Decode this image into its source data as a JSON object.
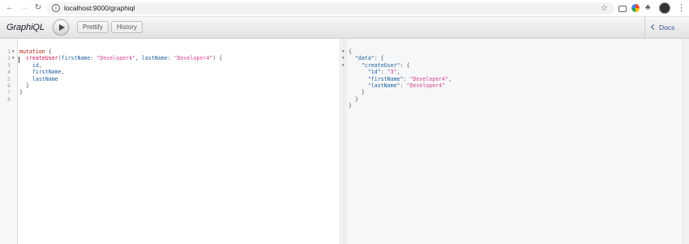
{
  "browser": {
    "url": "localhost:9000/graphiql",
    "back_icon": "arrow-left-icon",
    "forward_icon": "arrow-right-icon",
    "reload_icon": "reload-icon",
    "info_icon": "info-icon",
    "star_icon": "star-icon"
  },
  "toolbar": {
    "title": "GraphiQL",
    "prettify_label": "Prettify",
    "history_label": "History",
    "docs_label": "Docs"
  },
  "query_editor": {
    "line_numbers": [
      "1",
      "2",
      "3",
      "4",
      "5",
      "6",
      "7",
      "8"
    ],
    "lines": [
      [
        {
          "t": "mutation",
          "c": "kw"
        },
        {
          "t": " {",
          "c": "plain"
        }
      ],
      [
        {
          "t": "  ",
          "c": "plain"
        },
        {
          "t": "createUser",
          "c": "def"
        },
        {
          "t": "(",
          "c": "plain"
        },
        {
          "t": "firstName",
          "c": "attr"
        },
        {
          "t": ": ",
          "c": "plain"
        },
        {
          "t": "\"Developer4\"",
          "c": "str"
        },
        {
          "t": ", ",
          "c": "plain"
        },
        {
          "t": "lastName",
          "c": "attr"
        },
        {
          "t": ": ",
          "c": "plain"
        },
        {
          "t": "\"Developer4\"",
          "c": "str"
        },
        {
          "t": ") {",
          "c": "plain"
        }
      ],
      [
        {
          "t": "    ",
          "c": "plain"
        },
        {
          "t": "id",
          "c": "fld"
        },
        {
          "t": ",",
          "c": "plain"
        }
      ],
      [
        {
          "t": "    ",
          "c": "plain"
        },
        {
          "t": "firstName",
          "c": "fld"
        },
        {
          "t": ",",
          "c": "plain"
        }
      ],
      [
        {
          "t": "    ",
          "c": "plain"
        },
        {
          "t": "lastName",
          "c": "fld"
        }
      ],
      [
        {
          "t": "  }",
          "c": "plain"
        }
      ],
      [
        {
          "t": "}",
          "c": "plain"
        }
      ],
      [
        {
          "t": "",
          "c": "plain"
        }
      ]
    ]
  },
  "result_viewer": {
    "lines": [
      [
        {
          "t": "{",
          "c": "plain"
        }
      ],
      [
        {
          "t": "  ",
          "c": "plain"
        },
        {
          "t": "\"data\"",
          "c": "key"
        },
        {
          "t": ": {",
          "c": "plain"
        }
      ],
      [
        {
          "t": "    ",
          "c": "plain"
        },
        {
          "t": "\"createUser\"",
          "c": "key"
        },
        {
          "t": ": {",
          "c": "plain"
        }
      ],
      [
        {
          "t": "      ",
          "c": "plain"
        },
        {
          "t": "\"id\"",
          "c": "key"
        },
        {
          "t": ": ",
          "c": "plain"
        },
        {
          "t": "\"3\"",
          "c": "str"
        },
        {
          "t": ",",
          "c": "plain"
        }
      ],
      [
        {
          "t": "      ",
          "c": "plain"
        },
        {
          "t": "\"firstName\"",
          "c": "key"
        },
        {
          "t": ": ",
          "c": "plain"
        },
        {
          "t": "\"Developer4\"",
          "c": "str"
        },
        {
          "t": ",",
          "c": "plain"
        }
      ],
      [
        {
          "t": "      ",
          "c": "plain"
        },
        {
          "t": "\"lastName\"",
          "c": "key"
        },
        {
          "t": ": ",
          "c": "plain"
        },
        {
          "t": "\"Developer4\"",
          "c": "str"
        }
      ],
      [
        {
          "t": "    }",
          "c": "plain"
        }
      ],
      [
        {
          "t": "  }",
          "c": "plain"
        }
      ],
      [
        {
          "t": "}",
          "c": "plain"
        }
      ]
    ]
  },
  "colors": {
    "keyword": "#b11a04",
    "definition": "#d2054e",
    "attribute": "#1f61a0",
    "string": "#d64292",
    "docs_link": "#3b5998"
  }
}
